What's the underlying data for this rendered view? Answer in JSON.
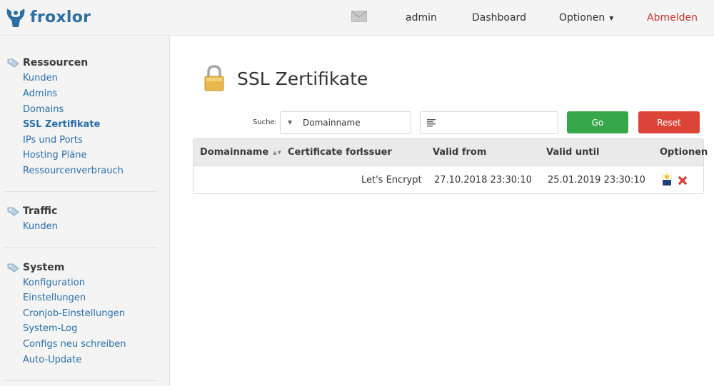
{
  "header": {
    "logo_text": "froxlor",
    "user": "admin",
    "nav_dashboard": "Dashboard",
    "nav_options": "Optionen",
    "nav_logout": "Abmelden"
  },
  "sidebar": {
    "sections": [
      {
        "title": "Ressourcen",
        "items": [
          "Kunden",
          "Admins",
          "Domains",
          "SSL Zertifikate",
          "IPs und Ports",
          "Hosting Pläne",
          "Ressourcenverbrauch"
        ],
        "active": "SSL Zertifikate"
      },
      {
        "title": "Traffic",
        "items": [
          "Kunden"
        ]
      },
      {
        "title": "System",
        "items": [
          "Konfiguration",
          "Einstellungen",
          "Cronjob-Einstellungen",
          "System-Log",
          "Configs neu schreiben",
          "Auto-Update"
        ]
      }
    ]
  },
  "main": {
    "page_title": "SSL Zertifikate",
    "search": {
      "label": "Suche:",
      "field_selected": "Domainname",
      "input_value": ""
    },
    "buttons": {
      "go": "Go",
      "reset": "Reset"
    },
    "table": {
      "columns": [
        "Domainname",
        "Certificate for",
        "Issuer",
        "Valid from",
        "Valid until",
        "Optionen"
      ],
      "rows": [
        {
          "domain": "",
          "certificate_for": "",
          "issuer": "Let's Encrypt",
          "valid_from": "27.10.2018 23:30:10",
          "valid_until": "25.01.2019 23:30:10"
        }
      ]
    }
  },
  "colors": {
    "brand": "#2d6fa3",
    "link": "#2a6fa8",
    "go_button": "#37a84a",
    "reset_button": "#dc4437",
    "logout": "#c0392b"
  },
  "icons": {
    "logo": "froxlor-logo-icon",
    "mail": "envelope-icon",
    "section": "tag-icon",
    "page": "padlock-icon",
    "search_input": "text-lines-icon",
    "edit_action": "edit-certificate-icon",
    "delete_action": "delete-x-icon"
  }
}
